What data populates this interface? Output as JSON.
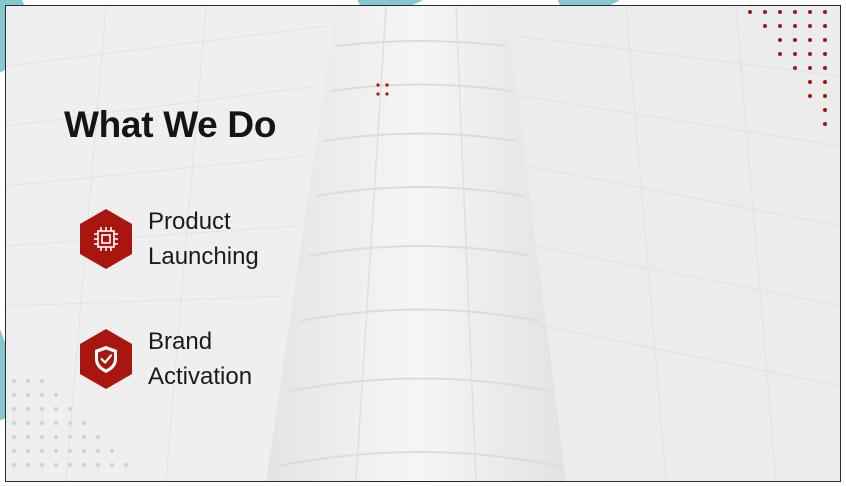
{
  "slide": {
    "title": "What We Do",
    "services": [
      {
        "icon": "chip-icon",
        "label_line1": "Product",
        "label_line2": "Launching"
      },
      {
        "icon": "shield-check-icon",
        "label_line1": "Brand",
        "label_line2": "Activation"
      }
    ]
  },
  "colors": {
    "accent": "#a8160f",
    "text": "#151515",
    "teal": "#5bb6bd",
    "background": "#f1f1f1"
  }
}
